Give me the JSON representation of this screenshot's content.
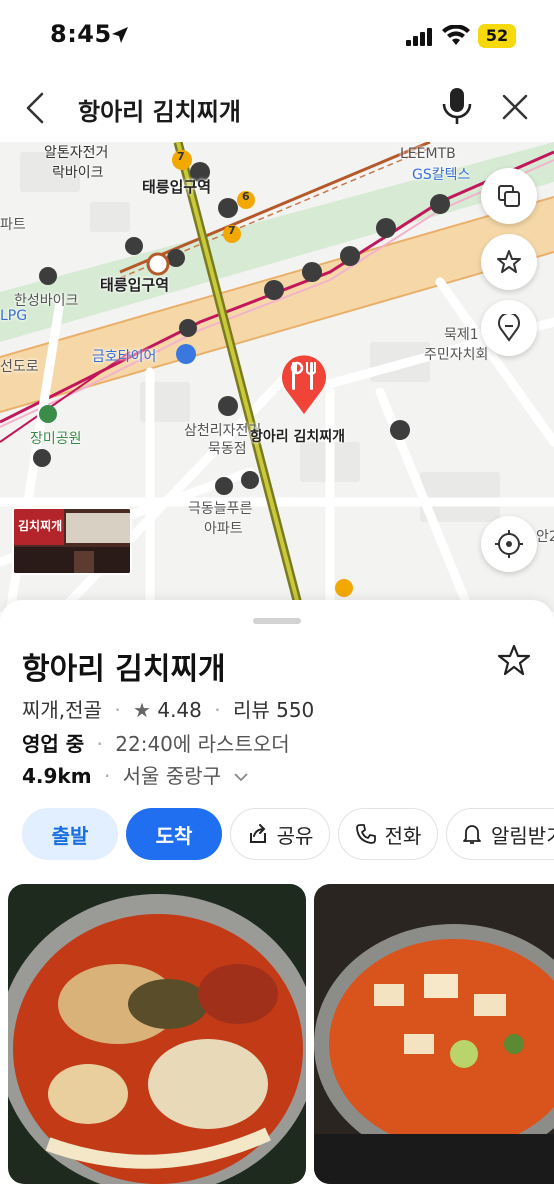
{
  "status_bar": {
    "time": "8:45",
    "battery": "52"
  },
  "search": {
    "query": "항아리 김치찌개"
  },
  "map": {
    "labels": {
      "bike1_line1": "알톤자전거",
      "bike1_line2": "락바이크",
      "station1": "태릉입구역",
      "station2": "태릉입구역",
      "leemtb": "LEEMTB",
      "gs": "GS칼텍스",
      "bike2": "한성바이크",
      "lpg": "LPG",
      "road": "선도로",
      "geumho": "금호타이어",
      "park": "장미공원",
      "samcheolli_line1": "삼천리자전거",
      "samcheolli_line2": "묵동점",
      "place": "항아리 김치찌개",
      "apt_line1": "극동늘푸른",
      "apt_line2": "아파트",
      "muk_line1": "묵제1",
      "muk_line2": "주민자치회",
      "left_cut": "파트",
      "right_cut": "안2",
      "line7a": "7",
      "line7b": "7",
      "line6": "6"
    },
    "thumb_text": "김치찌개"
  },
  "place": {
    "name": "항아리 김치찌개",
    "category": "찌개,전골",
    "rating": "4.48",
    "reviews": "리뷰 550",
    "status": "영업 중",
    "last_order": "22:40에 라스트오더",
    "distance": "4.9km",
    "region": "서울 중랑구"
  },
  "actions": {
    "depart": "출발",
    "arrive": "도착",
    "share": "공유",
    "call": "전화",
    "notify": "알림받기"
  },
  "colors": {
    "accent": "#1f6ff0",
    "accent_light": "#e2efff",
    "pin": "#f04438",
    "battery": "#f5d90a"
  }
}
